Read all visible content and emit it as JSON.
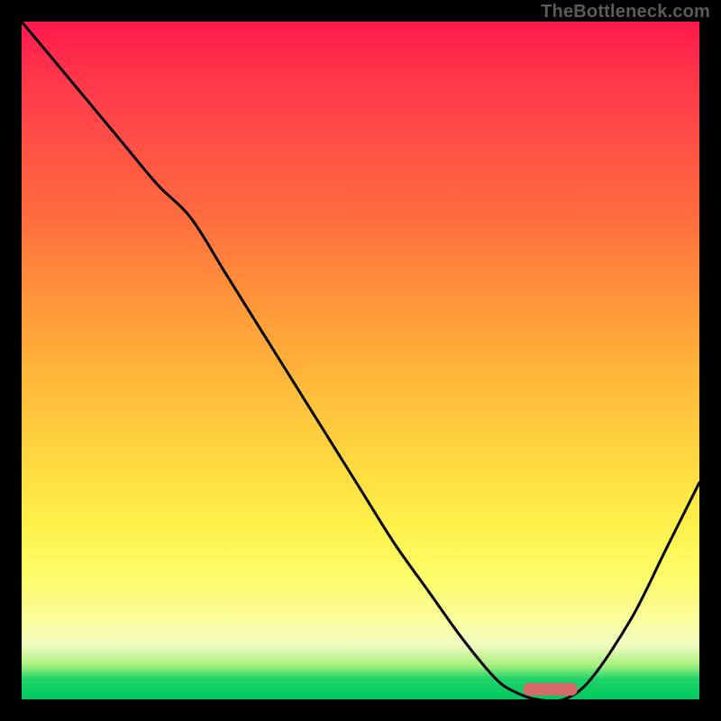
{
  "watermark_text": "TheBottleneck.com",
  "colors": {
    "background": "#000000",
    "curve": "#000000",
    "marker": "#d46a6a",
    "gradient_stops": [
      "#ff1a4d",
      "#ff3b4a",
      "#ff6a3f",
      "#ff923a",
      "#ffb53a",
      "#ffd63f",
      "#fff04a",
      "#fdfd6a",
      "#fbfc9a",
      "#f0fbc0",
      "#a6f07e",
      "#1fd36a",
      "#00c85f"
    ]
  },
  "chart_data": {
    "type": "line",
    "title": "",
    "xlabel": "",
    "ylabel": "",
    "xlim": [
      0,
      100
    ],
    "ylim": [
      0,
      100
    ],
    "x": [
      0,
      5,
      10,
      15,
      20,
      25,
      30,
      35,
      40,
      45,
      50,
      55,
      60,
      65,
      70,
      73,
      76,
      80,
      84,
      90,
      95,
      100
    ],
    "y": [
      100,
      94,
      88,
      82,
      76,
      71,
      63,
      55,
      47,
      39,
      31,
      23,
      16,
      9,
      3,
      1,
      0,
      0,
      3,
      12,
      22,
      32
    ],
    "marker": {
      "x_start": 74,
      "x_end": 82,
      "y": 1.5
    },
    "legend": false,
    "grid": false
  }
}
